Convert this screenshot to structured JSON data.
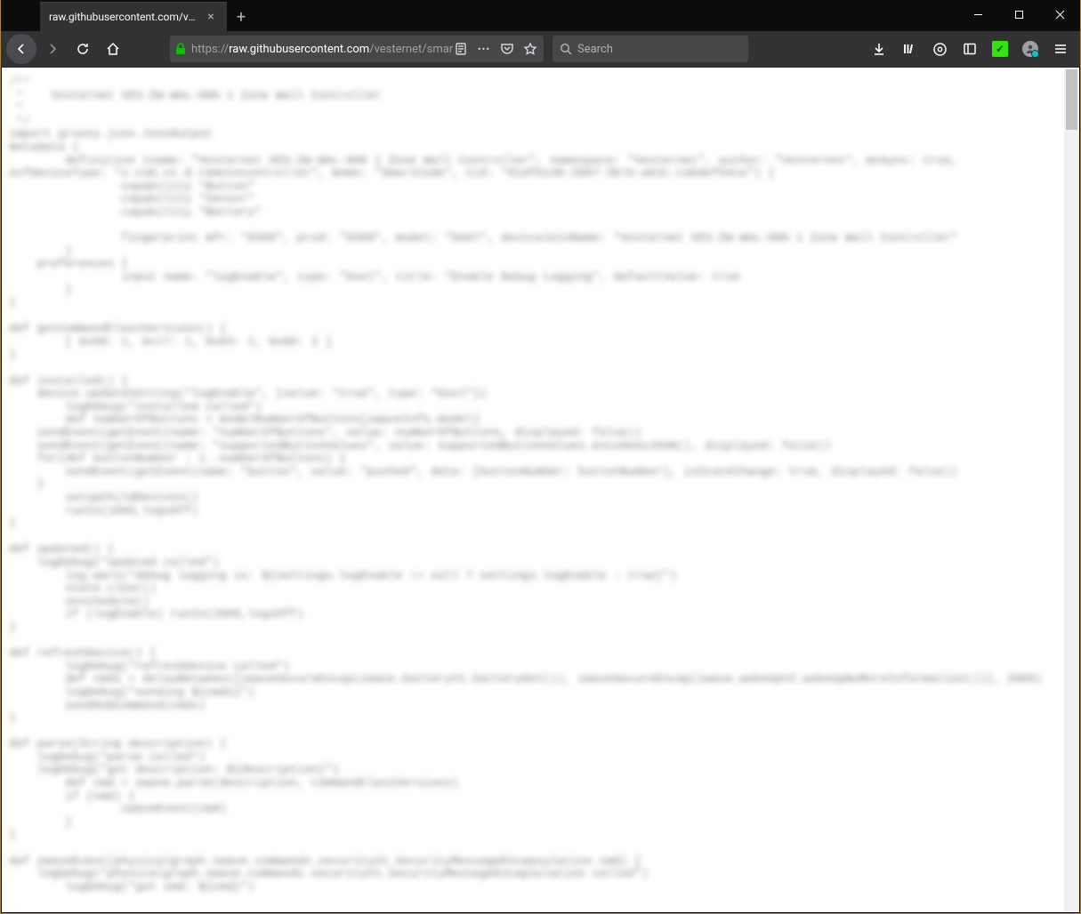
{
  "tab": {
    "title": "raw.githubusercontent.com/vestern",
    "close_label": "×"
  },
  "newtab": {
    "glyph": "+"
  },
  "window": {
    "minimize": "—",
    "maximize": "▢",
    "close": "✕"
  },
  "nav": {
    "back": "back",
    "forward": "forward",
    "reload": "reload",
    "home": "home"
  },
  "url": {
    "prefix": "https://",
    "domain": "raw.githubusercontent.com",
    "path": "/vesternet/smartthings-z-w"
  },
  "url_icons": {
    "reader": "reader-mode-icon",
    "more": "•••",
    "pocket": "pocket-icon",
    "star": "star-icon"
  },
  "search": {
    "placeholder": "Search"
  },
  "right": {
    "download": "download-icon",
    "library": "library-icon",
    "ext1": "extension-circle-icon",
    "sidebar": "sidebar-icon",
    "check": "✓",
    "avatar": "account-avatar",
    "menu": "hamburger-menu-icon"
  },
  "code": "/**\n *    Vesternet VES-ZW-WAL-000 1 Zone Wall Controller\n *\n */\nimport groovy.json.JsonOutput\nmetadata {\n        definition (name: \"Vesternet VES-ZW-WAL-000 1 Zone Wall Controller\", namespace: \"Vesternet\", author: \"Vesternet\", mnSync: true,\nocfDeviceType: \"x.com.st.d.remotecontroller\", mnmn: \"SmartCode\", vid: \"01dfb148-2007-3b7e-ab3c-cabdef54ce\") {\n                capability \"Button\"\n                capability \"Sensor\"\n                capability \"Battery\"\n\n                fingerprint mfr: \"0300\", prod: \"0300\", model: \"8A07\", deviceJoinName: \"Vesternet VES-ZW-WAL-000 1 Zone Wall Controller\"\n        }\n    preferences {\n                input name: \"logEnable\", type: \"bool\", title: \"Enable Debug Logging\", defaultValue: true\n        }\n}\n\ndef getCommandClassVersions() {\n        [ 0x60: 1, 0x77: 1, 0x83: 1, 0x88: 2 ]\n}\n\ndef installed() {\n    device.updateSetting(\"logEnable\", [value: \"true\", type: \"bool\"])\n        logDebug(\"installed called\")\n        def numberOfButtons = modelNumberOfButtons[zwaveInfo.model]\n    sendEvent(getEvent(name: \"numberOfButtons\", value: numberOfButtons, displayed: false))\n    sendEvent(getEvent(name: \"supportedButtonValues\", value: supportedButtonValues.encodeAsJSON(), displayed: false))\n    for(def buttonNumber : 1..numberOfButtons) {\n        sendEvent(getEvent(name: \"button\", value: \"pushed\", data: [buttonNumber: buttonNumber], isStateChange: true, displayed: false))\n    }\n        setupChildDevices()\n        runIn(1000,logsOff)\n}\n\ndef updated() {\n    logDebug(\"updated called\")\n        log.warn(\"debug logging is: ${settings.logEnable != null ? settings.logEnable : true}\")\n        state.clear()\n        unschedule()\n        if (logEnable) runIn(1000,logsOff)\n}\n\ndef refreshDevice() {\n        logDebug(\"refreshDevice called\")\n        def cmds = delayBetween([zwaveSecureEncap(zwave.batteryV1.batteryGet()), zwaveSecureEncap(zwave.wakeUpV2.wakeUpNoMoreInformation())], 2000)\n        logDebug(\"sending ${cmds}\")\n        sendHubCommand(cmds)\n}\n\ndef parse(String description) {\n    logDebug(\"parse called\")\n    logDebug(\"got description: ${description}\")\n        def cmd = zwave.parse(description, commandClassVersions)\n        if (cmd) {\n                zwaveEvent(cmd)\n        }\n}\n\ndef zwaveEvent(physicalgraph.zwave.commands.securityV1.SecurityMessageEncapsulation cmd) {\n    logDebug(\"physicalgraph.zwave.commands.securityV1.SecurityMessageEncapsulation called\")\n        logDebug(\"got cmd: ${cmd}\")"
}
